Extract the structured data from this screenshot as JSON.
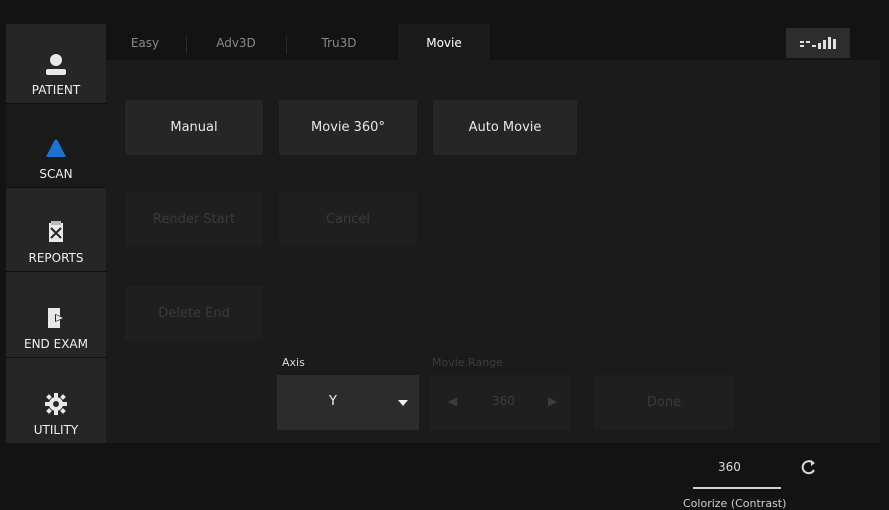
{
  "nav": {
    "items": [
      {
        "label": "PATIENT",
        "icon": "person-icon"
      },
      {
        "label": "SCAN",
        "icon": "probe-icon"
      },
      {
        "label": "REPORTS",
        "icon": "report-icon"
      },
      {
        "label": "END EXAM",
        "icon": "exit-icon"
      },
      {
        "label": "UTILITY",
        "icon": "gear-icon"
      }
    ]
  },
  "tabs": [
    "Easy",
    "Adv3D",
    "Tru3D",
    "Movie"
  ],
  "active_tab": "Movie",
  "top_right_icon": "levels-icon",
  "buttons": {
    "manual": "Manual",
    "movie360": "Movie 360°",
    "auto_movie": "Auto Movie",
    "render_start": "Render Start",
    "cancel": "Cancel",
    "delete_end": "Delete End"
  },
  "axis": {
    "label": "Axis",
    "value": "Y"
  },
  "stepper": {
    "label": "Movie Range",
    "value": "360"
  },
  "extra_button": "Done",
  "slider": {
    "value": "360",
    "label": "Colorize (Contrast)"
  },
  "colors": {
    "background": "#131313",
    "panel": "#1b1b1b",
    "button": "#262626",
    "accent_blue": "#1e72d0",
    "text": "#e6e6e6"
  }
}
